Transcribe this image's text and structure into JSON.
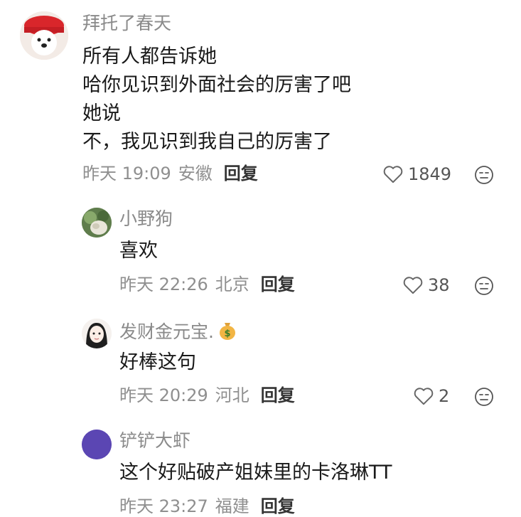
{
  "comments": [
    {
      "username": "拜托了春天",
      "lines": [
        "所有人都告诉她",
        "哈你见识到外面社会的厉害了吧",
        "她说",
        "不，我见识到我自己的厉害了"
      ],
      "time": "昨天 19:09",
      "location": "安徽",
      "reply_label": "回复",
      "likes": "1849",
      "avatar_icon": "red-hat-dog-avatar"
    },
    {
      "username": "小野狗",
      "lines": [
        "喜欢"
      ],
      "time": "昨天 22:26",
      "location": "北京",
      "reply_label": "回复",
      "likes": "38",
      "avatar_icon": "plant-photo-avatar"
    },
    {
      "username": "发财金元宝.",
      "username_emoji": "money-bag-icon",
      "lines": [
        "好棒这句"
      ],
      "time": "昨天 20:29",
      "location": "河北",
      "reply_label": "回复",
      "likes": "2",
      "avatar_icon": "girl-drawing-avatar"
    },
    {
      "username": "铲铲大虾",
      "lines": [
        "这个好贴破产姐妹里的卡洛琳TT"
      ],
      "time": "昨天 23:27",
      "location": "福建",
      "reply_label": "回复",
      "avatar_icon": "purple-circle-avatar"
    }
  ],
  "colors": {
    "username": "#8a8a8a",
    "meta": "#8f8f8f",
    "reply": "#333333",
    "purple_avatar": "#5b46b3"
  }
}
